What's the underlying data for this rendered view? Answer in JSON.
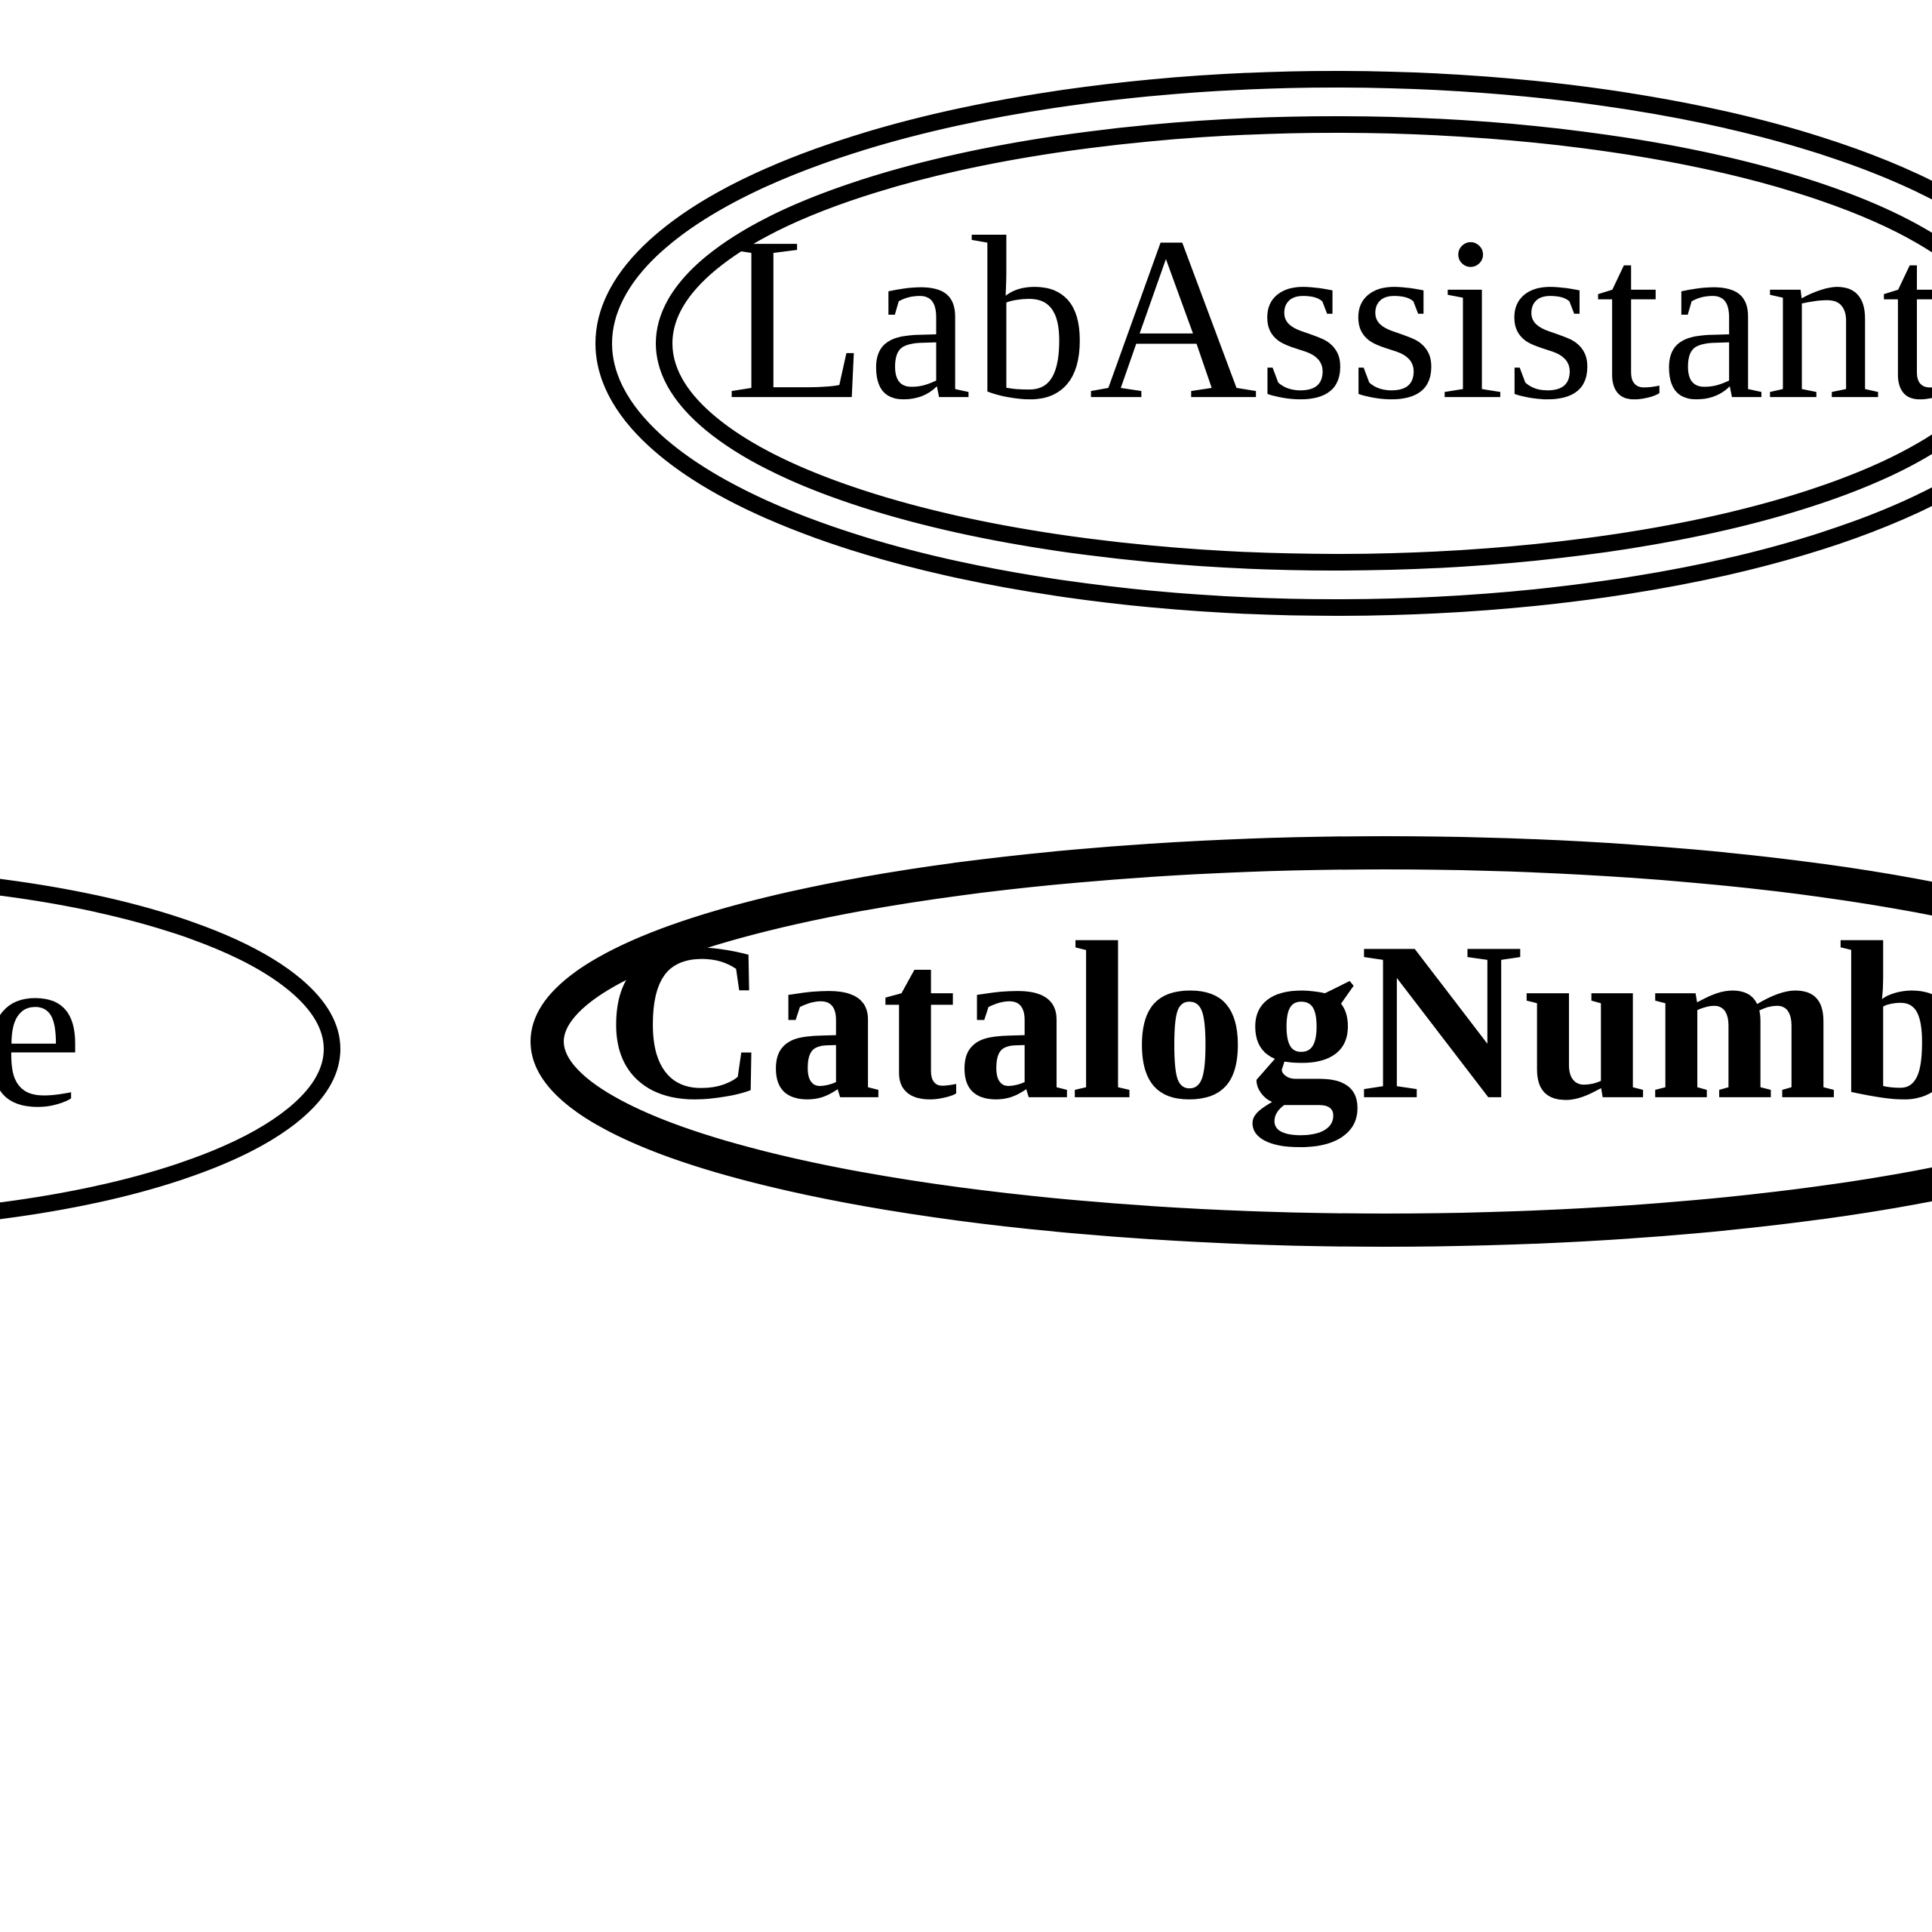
{
  "diagram": {
    "nodes": {
      "labAssistant": {
        "label": "LabAssistant",
        "type": "entity-set-weak"
      },
      "catalogNumber": {
        "label": "CatalogNumber",
        "type": "attribute-key"
      },
      "dePartial": {
        "label": "de",
        "type": "attribute-partial"
      }
    }
  },
  "style": {
    "stroke": "#000000",
    "background": "#ffffff"
  }
}
